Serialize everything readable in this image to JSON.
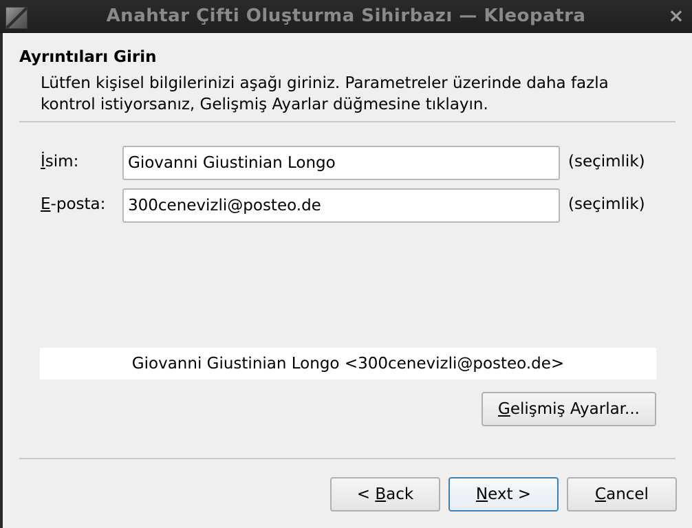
{
  "window": {
    "title": "Anahtar Çifti Oluşturma Sihirbazı — Kleopatra",
    "close_glyph": "×"
  },
  "page": {
    "heading": "Ayrıntıları Girin",
    "subtitle": "Lütfen kişisel bilgilerinizi aşağı giriniz. Parametreler üzerinde daha fazla kontrol istiyorsanız, Gelişmiş Ayarlar düğmesine tıklayın."
  },
  "form": {
    "name": {
      "label_mnemonic": "İ",
      "label_rest": "sim:",
      "value": "Giovanni Giustinian Longo",
      "optional": "(seçimlik)"
    },
    "email": {
      "label_mnemonic": "E",
      "label_rest": "-posta:",
      "value": "300cenevizli@posteo.de",
      "optional": "(seçimlik)"
    }
  },
  "preview": "Giovanni Giustinian Longo <300cenevizli@posteo.de>",
  "buttons": {
    "advanced": {
      "mnemonic": "G",
      "rest": "elişmiş Ayarlar..."
    },
    "back": {
      "prefix": "< ",
      "mnemonic": "B",
      "rest": "ack"
    },
    "next": {
      "mnemonic": "N",
      "rest": "ext >"
    },
    "cancel": {
      "mnemonic": "C",
      "rest": "ancel"
    }
  },
  "colors": {
    "titlebar": "#2a2a2a",
    "dialog_bg": "#efefef",
    "focus_border": "#3c80b8"
  },
  "icons": {
    "app": "kleopatra-app-icon",
    "close": "close-icon"
  }
}
